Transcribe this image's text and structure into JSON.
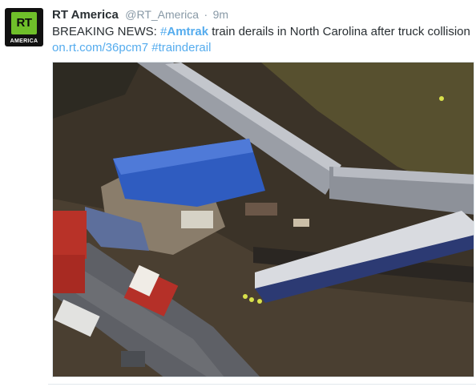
{
  "tweet": {
    "avatar_text": "RT",
    "avatar_subtext": "AMERICA",
    "name": "RT America",
    "handle": "@RT_America",
    "separator": "·",
    "time": "9m",
    "text_prefix": "BREAKING NEWS: ",
    "hashtag_symbol": "#",
    "hashtag_word": "Amtrak",
    "text_middle": " train derails in North Carolina after truck collision",
    "link": "on.rt.com/36pcm7",
    "hashtag2": "#trainderail"
  },
  "colors": {
    "link": "#55acee",
    "brand_green": "#6fbf2a"
  }
}
